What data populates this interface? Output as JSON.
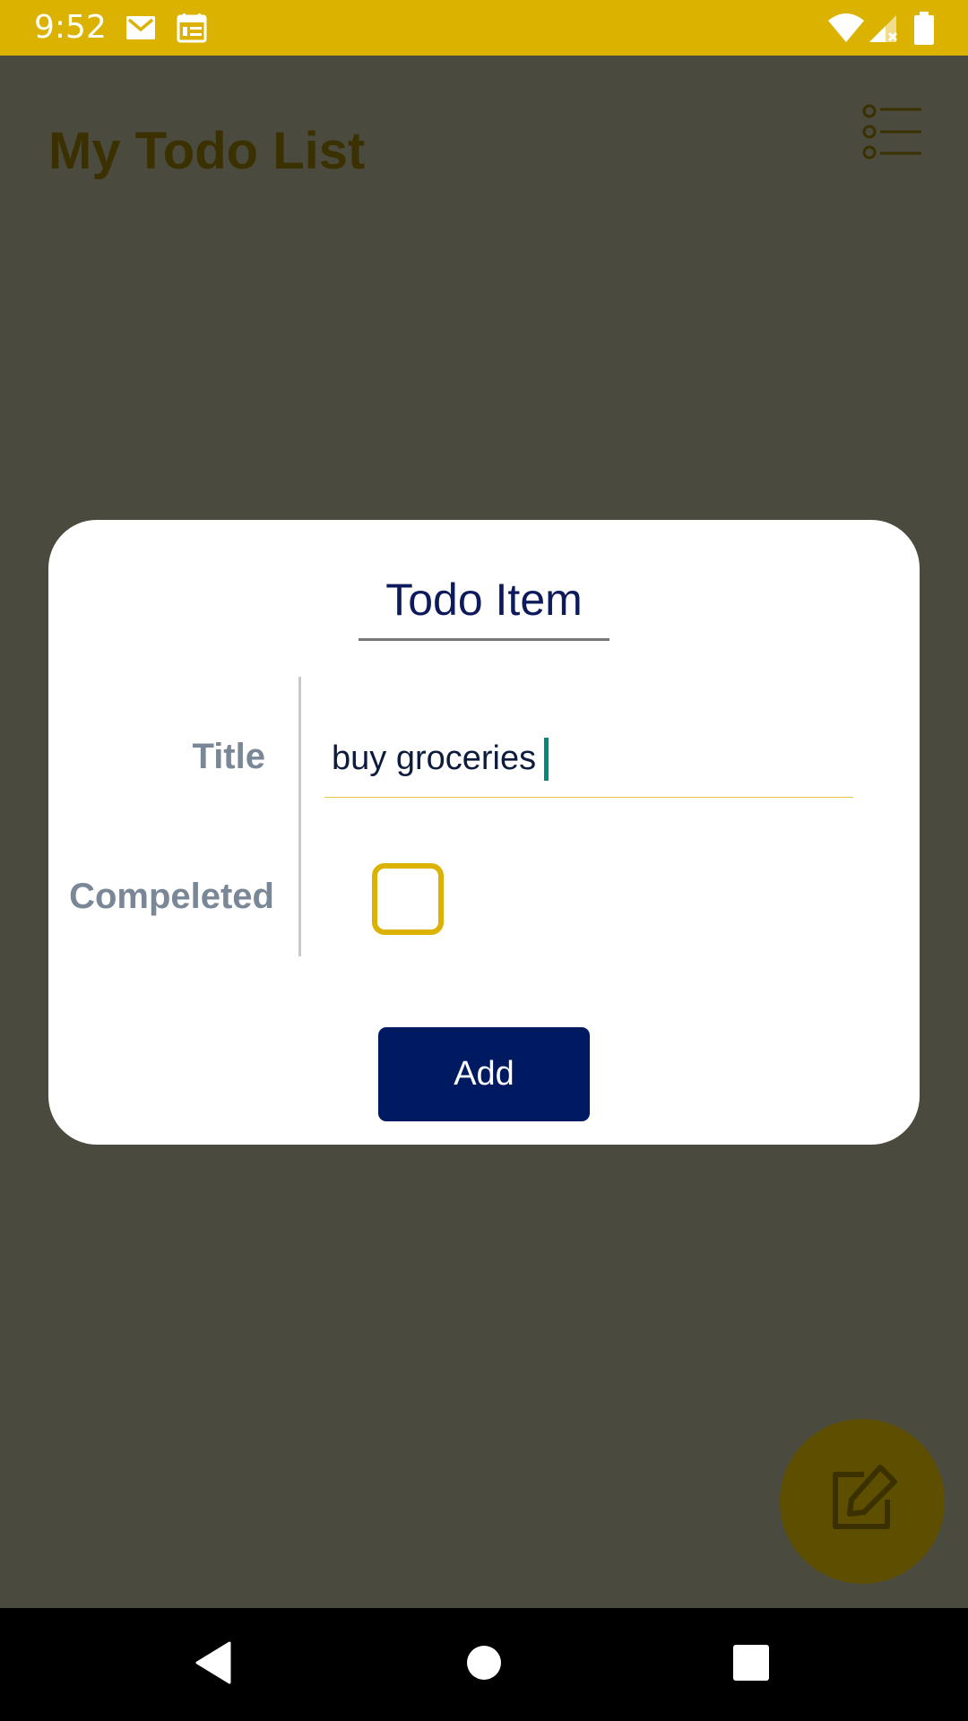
{
  "status_bar": {
    "time": "9:52",
    "left_icons": [
      "gmail-icon",
      "calendar-icon"
    ],
    "right_icons": [
      "wifi-icon",
      "cell-signal-icon",
      "battery-icon"
    ],
    "color": "#dcb200"
  },
  "app": {
    "title": "My Todo List",
    "menu_icon": "list-icon"
  },
  "dialog": {
    "title": "Todo Item",
    "fields": {
      "title_label": "Title",
      "title_value": "buy groceries",
      "completed_label": "Compeleted",
      "completed_checked": false
    },
    "add_button_label": "Add"
  },
  "fab": {
    "icon": "edit-icon"
  },
  "nav_bar": {
    "buttons": [
      "back-icon",
      "home-icon",
      "recents-icon"
    ]
  },
  "colors": {
    "accent": "#dcb200",
    "primary": "#001a62",
    "label": "#7a8797",
    "scrim_background": "#4b4a3f"
  }
}
